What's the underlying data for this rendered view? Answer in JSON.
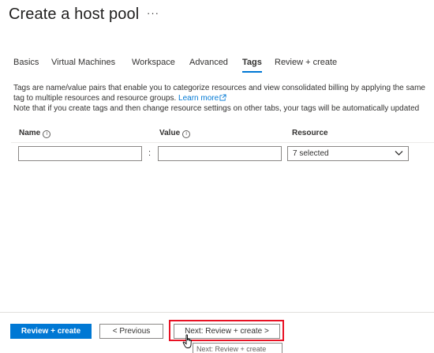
{
  "header": {
    "title": "Create a host pool",
    "more_label": "···"
  },
  "tabs": [
    {
      "label": "Basics",
      "active": false
    },
    {
      "label": "Virtual Machines",
      "active": false
    },
    {
      "label": "Workspace",
      "active": false
    },
    {
      "label": "Advanced",
      "active": false
    },
    {
      "label": "Tags",
      "active": true
    },
    {
      "label": "Review + create",
      "active": false
    }
  ],
  "description": {
    "line1": "Tags are name/value pairs that enable you to categorize resources and view consolidated billing by applying the same tag to multiple resources and resource groups.",
    "learn_more": "Learn more",
    "line2": "Note that if you create tags and then change resource settings on other tabs, your tags will be automatically updated"
  },
  "tags_table": {
    "headers": {
      "name": "Name",
      "value": "Value",
      "resource": "Resource"
    },
    "info_icon": "info-icon",
    "row": {
      "name_value": "",
      "separator": ":",
      "value_value": "",
      "resource_selected": "7 selected"
    }
  },
  "footer": {
    "review_create": "Review + create",
    "previous": "< Previous",
    "next": "Next: Review + create >",
    "tooltip": "Next: Review + create"
  },
  "colors": {
    "accent": "#0078d4",
    "highlight": "#e81123"
  }
}
